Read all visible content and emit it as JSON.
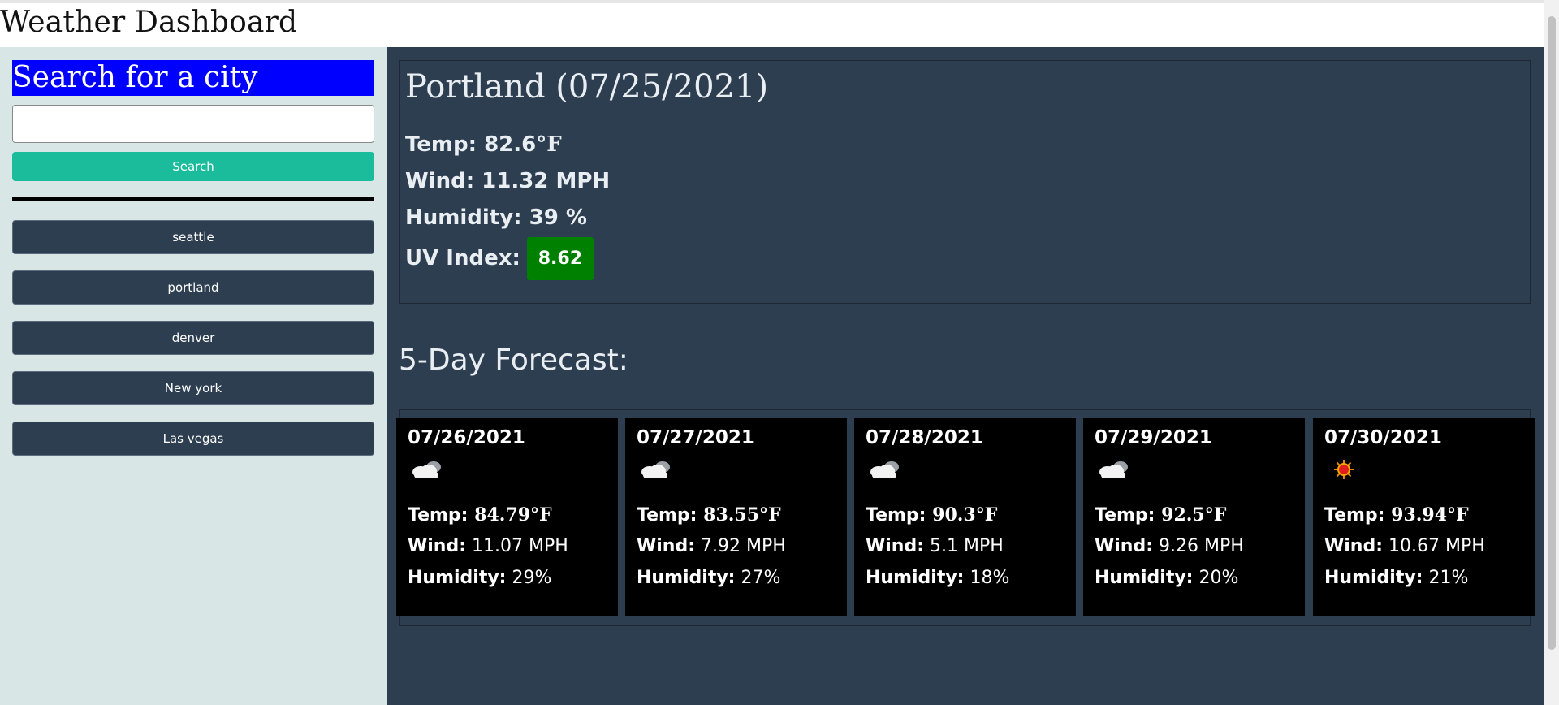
{
  "app": {
    "title": "Weather Dashboard"
  },
  "sidebar": {
    "search_heading": "Search for a city",
    "search_input_value": "",
    "search_input_placeholder": "",
    "search_button_label": "Search",
    "history": [
      {
        "label": "seattle"
      },
      {
        "label": "portland"
      },
      {
        "label": "denver"
      },
      {
        "label": "New york"
      },
      {
        "label": "Las vegas"
      }
    ]
  },
  "current": {
    "city_title": "Portland (07/25/2021)",
    "temp_label": "Temp: ",
    "temp_value": "82.6",
    "temp_unit": "°F",
    "wind_text": "Wind: 11.32 MPH",
    "humidity_text": "Humidity: 39 %",
    "uv_label": "UV Index:",
    "uv_value": "8.62",
    "uv_color": "#008000"
  },
  "forecast": {
    "title": "5-Day Forecast:",
    "temp_label": "Temp: ",
    "wind_label": "Wind:",
    "humidity_label": "Humidity:",
    "days": [
      {
        "date": "07/26/2021",
        "icon": "cloud-icon",
        "temp": "84.79°F",
        "wind": " 11.07 MPH",
        "humidity": " 29%"
      },
      {
        "date": "07/27/2021",
        "icon": "cloud-icon",
        "temp": "83.55°F",
        "wind": " 7.92 MPH",
        "humidity": " 27%"
      },
      {
        "date": "07/28/2021",
        "icon": "cloud-icon",
        "temp": "90.3°F",
        "wind": " 5.1 MPH",
        "humidity": " 18%"
      },
      {
        "date": "07/29/2021",
        "icon": "cloud-icon",
        "temp": "92.5°F",
        "wind": " 9.26 MPH",
        "humidity": " 20%"
      },
      {
        "date": "07/30/2021",
        "icon": "sun-icon",
        "temp": "93.94°F",
        "wind": " 10.67 MPH",
        "humidity": " 21%"
      }
    ]
  },
  "colors": {
    "sidebar_bg": "#d8e7e6",
    "main_bg": "#2d3e50",
    "accent_search": "#1abc9c",
    "heading_highlight": "#0000ff",
    "card_bg": "#000000"
  }
}
